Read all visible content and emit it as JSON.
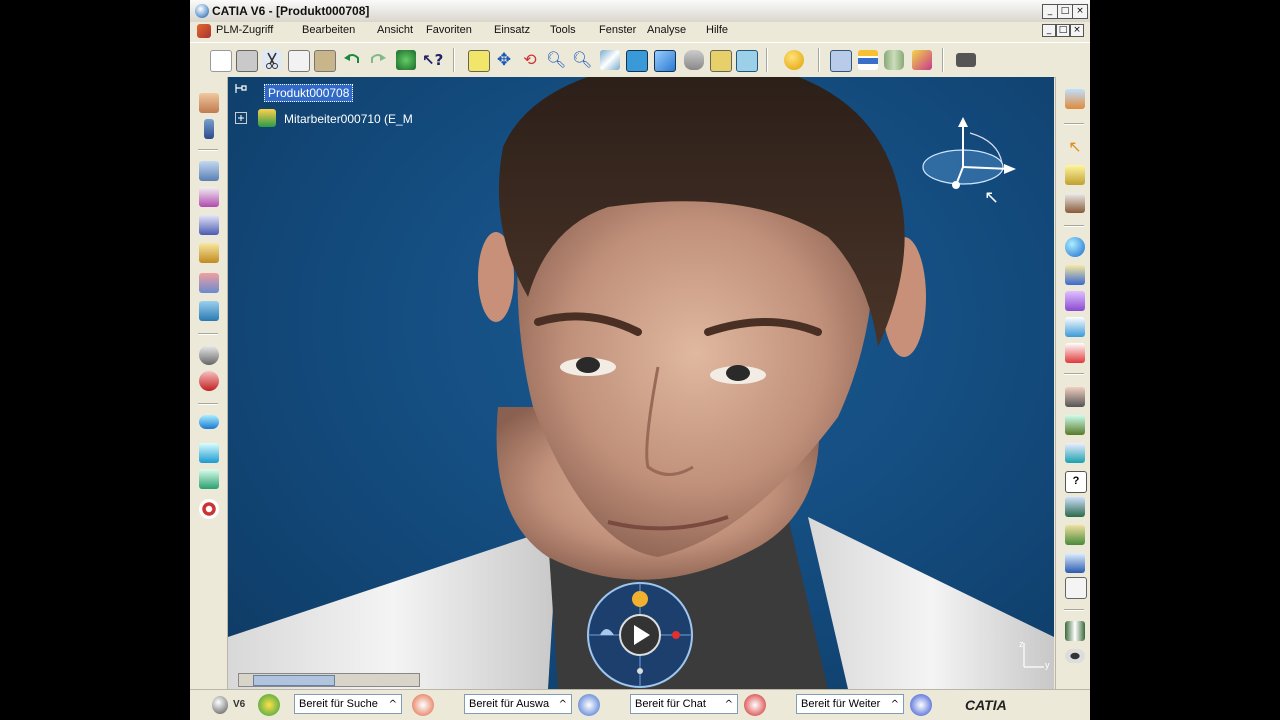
{
  "window": {
    "title": "CATIA V6 - [Produkt000708]",
    "controls": [
      "_",
      "□",
      "×"
    ],
    "mdi_controls": [
      "_",
      "□",
      "×"
    ]
  },
  "menubar": {
    "items": [
      "PLM-Zugriff",
      "Bearbeiten",
      "Ansicht",
      "Favoriten",
      "Einsatz",
      "Tools",
      "Fenster",
      "Analyse",
      "Hilfe"
    ]
  },
  "tree": {
    "root": "Produkt000708",
    "child": "Mitarbeiter000710 (E_M"
  },
  "compass": {
    "axes": [
      "z",
      "y"
    ]
  },
  "statusbar": {
    "version": "V6",
    "fields": [
      "Bereit für Suche",
      "Bereit für Auswa",
      "Bereit für Chat",
      "Bereit für Weiter"
    ],
    "chevron": "^",
    "brand": "CATIA"
  },
  "colors": {
    "viewport_bg": "#134a7c",
    "selection": "#3169c6",
    "window_chrome": "#ece9d8"
  },
  "icons": {
    "toolbar": [
      "new-icon",
      "open-icon",
      "print-icon",
      "cut-icon",
      "copy-icon",
      "paste-icon",
      "undo-icon",
      "redo-icon",
      "refresh-icon",
      "whats-this-icon",
      "fit-all-icon",
      "pan-icon",
      "rotate-icon",
      "zoom-in-icon",
      "zoom-out-icon",
      "normal-view-icon",
      "quick-view-icon",
      "iso-view-icon",
      "render-style-icon",
      "hide-show-icon",
      "swap-space-icon",
      "sphere-icon",
      "plm-properties-icon",
      "measure-icon",
      "cylinder-icon",
      "box-icon",
      "camera-icon"
    ],
    "left": [
      "manikin-icon",
      "posture-icon",
      "walk-icon",
      "reach-icon",
      "angle-icon",
      "forward-kinematics-icon",
      "move-icon",
      "assembly-icon",
      "vision-icon",
      "eye-icon",
      "pill-icon",
      "link-icon",
      "chain-icon",
      "target-icon"
    ],
    "right": [
      "manikin-standing-icon",
      "select-icon",
      "select-trap-icon",
      "tree-expand-icon",
      "sphere-add-icon",
      "catalog-icon",
      "clipboard-icon",
      "shapes-icon",
      "shapes-red-icon",
      "person-add-icon",
      "person-weight-icon",
      "measure-add-icon",
      "help-icon",
      "walk-person-icon",
      "workers-icon",
      "upload-icon",
      "report-icon",
      "film-icon",
      "look-icon"
    ]
  }
}
